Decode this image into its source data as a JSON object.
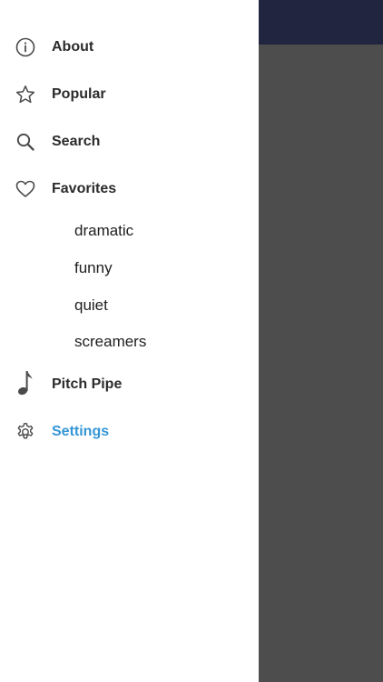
{
  "menu": {
    "about": {
      "label": "About",
      "icon": "info-icon"
    },
    "popular": {
      "label": "Popular",
      "icon": "star-icon"
    },
    "search": {
      "label": "Search",
      "icon": "search-icon"
    },
    "favorites": {
      "label": "Favorites",
      "icon": "heart-icon",
      "sub_items": [
        "dramatic",
        "funny",
        "quiet",
        "screamers"
      ]
    },
    "pitch_pipe": {
      "label": "Pitch Pipe",
      "icon": "music-note-icon"
    },
    "settings": {
      "label": "Settings",
      "icon": "gear-icon",
      "active": true
    }
  },
  "colors": {
    "header_bar": "#222540",
    "overlay": "#4d4d4d",
    "active_text": "#3596d6",
    "icon_stroke": "#4a4a4a"
  }
}
